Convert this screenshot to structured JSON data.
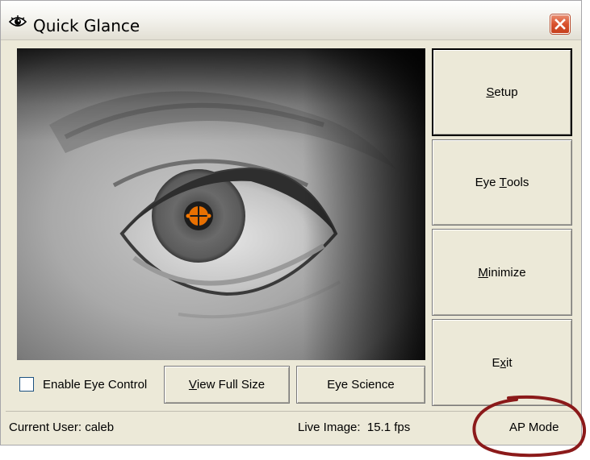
{
  "window": {
    "title": "Quick Glance"
  },
  "buttons": {
    "setup": {
      "pre": "",
      "key": "S",
      "post": "etup"
    },
    "eye_tools": {
      "pre": "Eye ",
      "key": "T",
      "post": "ools"
    },
    "minimize": {
      "pre": "",
      "key": "M",
      "post": "inimize"
    },
    "exit": {
      "pre": "E",
      "key": "x",
      "post": "it"
    },
    "view_full_size": {
      "pre": "",
      "key": "V",
      "post": "iew Full Size"
    },
    "eye_science": {
      "label": "Eye Science"
    }
  },
  "controls": {
    "enable_eye_control": {
      "label": "Enable Eye Control",
      "checked": false
    }
  },
  "status": {
    "current_user": "Current User: caleb",
    "live_image": "Live Image:  15.1 fps",
    "mode": "AP Mode"
  },
  "icons": {
    "app": "eye-icon",
    "close": "close-icon",
    "crosshair": "crosshair-icon"
  },
  "colors": {
    "close_button": "#d9512d",
    "annotation_circle": "#8b1a1a",
    "crosshair": "#ff7a00"
  }
}
